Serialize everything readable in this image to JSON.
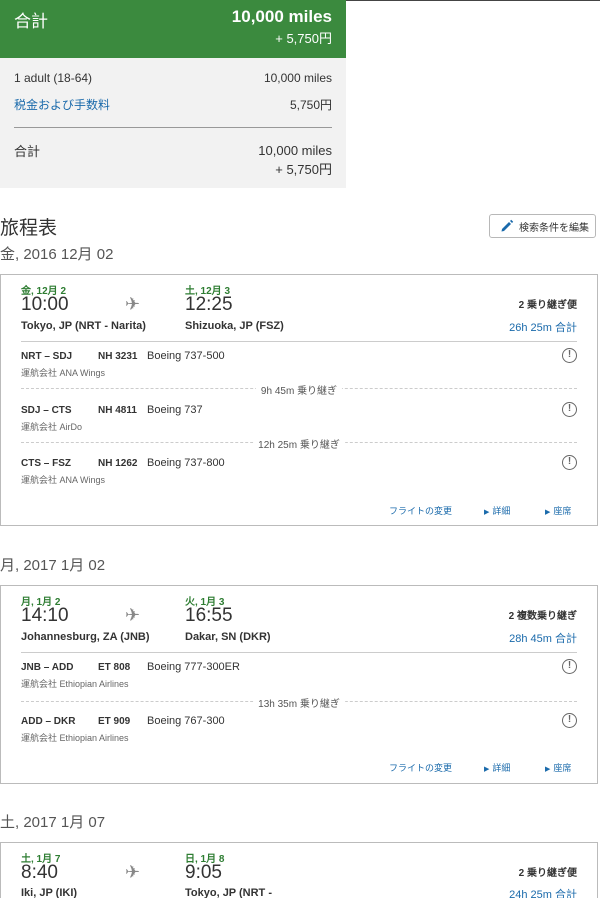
{
  "summary": {
    "label": "合計",
    "miles": "10,000 miles",
    "yen": "+ 5,750円",
    "rows": [
      {
        "label": "1 adult (18-64)",
        "value": "10,000 miles"
      },
      {
        "label": "税金および手数料",
        "value": "5,750円"
      }
    ],
    "total_label": "合計",
    "total_miles": "10,000 miles",
    "total_yen": "+ 5,750円"
  },
  "itinerary_title": "旅程表",
  "edit_button": "検索条件を編集",
  "colors": {
    "accent_green": "#3b8a3e",
    "link_blue": "#1a6aab"
  },
  "trips": [
    {
      "date_header": "金, 2016 12月 02",
      "dep_date": "金, 12月 2",
      "dep_time": "10:00",
      "dep_airport": "Tokyo, JP (NRT - Narita)",
      "arr_date": "土, 12月 3",
      "arr_time": "12:25",
      "arr_airport": "Shizuoka, JP (FSZ)",
      "stops": "2 乗り継ぎ便",
      "duration": "26h 25m 合計",
      "segments": [
        {
          "route": "NRT – SDJ",
          "flight": "NH 3231",
          "aircraft": "Boeing 737-500",
          "operator": "運航会社 ANA Wings"
        },
        {
          "route": "SDJ – CTS",
          "flight": "NH 4811",
          "aircraft": "Boeing 737",
          "operator": "運航会社 AirDo"
        },
        {
          "route": "CTS – FSZ",
          "flight": "NH 1262",
          "aircraft": "Boeing 737-800",
          "operator": "運航会社 ANA Wings"
        }
      ],
      "layovers": [
        "9h 45m 乗り継ぎ",
        "12h 25m 乗り継ぎ"
      ],
      "actions": {
        "change": "フライトの変更",
        "details": "詳細",
        "seats": "座席"
      }
    },
    {
      "date_header": "月, 2017 1月 02",
      "dep_date": "月, 1月 2",
      "dep_time": "14:10",
      "dep_airport": "Johannesburg, ZA (JNB)",
      "arr_date": "火, 1月 3",
      "arr_time": "16:55",
      "arr_airport": "Dakar, SN (DKR)",
      "stops": "2 複数乗り継ぎ",
      "duration": "28h 45m 合計",
      "segments": [
        {
          "route": "JNB – ADD",
          "flight": "ET 808",
          "aircraft": "Boeing 777-300ER",
          "operator": "運航会社 Ethiopian Airlines"
        },
        {
          "route": "ADD – DKR",
          "flight": "ET 909",
          "aircraft": "Boeing 767-300",
          "operator": "運航会社 Ethiopian Airlines"
        }
      ],
      "layovers": [
        "13h 35m 乗り継ぎ"
      ],
      "actions": {
        "change": "フライトの変更",
        "details": "詳細",
        "seats": "座席"
      }
    },
    {
      "date_header": "土, 2017 1月 07",
      "dep_date": "土, 1月 7",
      "dep_time": "8:40",
      "dep_airport": "Iki, JP (IKI)",
      "arr_date": "日, 1月 8",
      "arr_time": "9:05",
      "arr_airport": "Tokyo, JP (NRT -",
      "stops": "2 乗り継ぎ便",
      "duration": "24h 25m 合計"
    }
  ]
}
